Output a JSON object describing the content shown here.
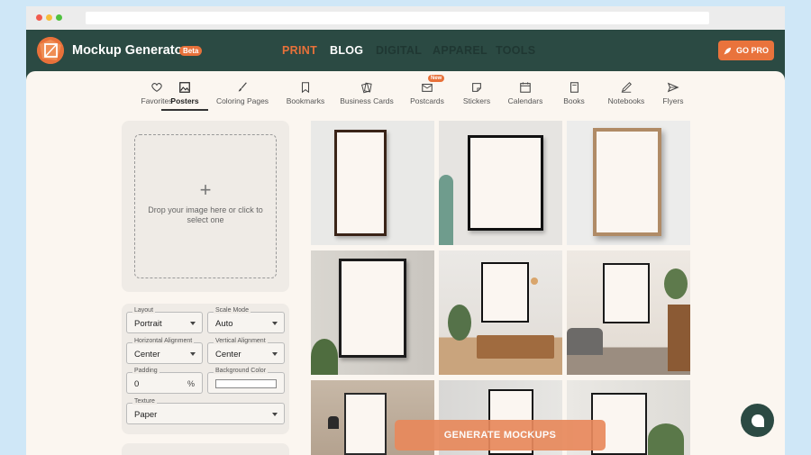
{
  "app": {
    "brand": "Mockup Generator",
    "badge": "Beta",
    "go_pro": "GO PRO"
  },
  "nav": [
    {
      "label": "PRINT",
      "color": "#e8713a"
    },
    {
      "label": "BLOG",
      "color": "#ffffff"
    },
    {
      "label": "DIGITAL",
      "color": "#1f3732"
    },
    {
      "label": "APPAREL",
      "color": "#1f3732"
    },
    {
      "label": "TOOLS",
      "color": "#1f3732"
    }
  ],
  "tabs": [
    {
      "label": "Favorites",
      "icon": "heart-icon"
    },
    {
      "label": "Posters",
      "icon": "image-icon",
      "active": true
    },
    {
      "label": "Coloring Pages",
      "icon": "brush-icon"
    },
    {
      "label": "Bookmarks",
      "icon": "bookmark-icon"
    },
    {
      "label": "Business Cards",
      "icon": "cards-icon"
    },
    {
      "label": "Postcards",
      "icon": "postcard-icon",
      "badge": "New"
    },
    {
      "label": "Stickers",
      "icon": "sticker-icon"
    },
    {
      "label": "Calendars",
      "icon": "calendar-icon"
    },
    {
      "label": "Books",
      "icon": "book-icon"
    },
    {
      "label": "Notebooks",
      "icon": "notebook-icon"
    },
    {
      "label": "Flyers",
      "icon": "send-icon"
    }
  ],
  "upload": {
    "plus": "+",
    "text": "Drop your image here or click to select one"
  },
  "settings": {
    "layout": {
      "label": "Layout",
      "value": "Portrait"
    },
    "scale_mode": {
      "label": "Scale Mode",
      "value": "Auto"
    },
    "horizontal_alignment": {
      "label": "Horizontal Alignment",
      "value": "Center"
    },
    "vertical_alignment": {
      "label": "Vertical Alignment",
      "value": "Center"
    },
    "padding": {
      "label": "Padding",
      "value": "0",
      "unit": "%"
    },
    "background_color": {
      "label": "Background Color",
      "value": "#ffffff"
    },
    "texture": {
      "label": "Texture",
      "value": "Paper"
    }
  },
  "generate": "GENERATE MOCKUPS",
  "colors": {
    "topbar": "#2b4a43",
    "accent": "#e8713a",
    "page": "#fbf6f0"
  }
}
